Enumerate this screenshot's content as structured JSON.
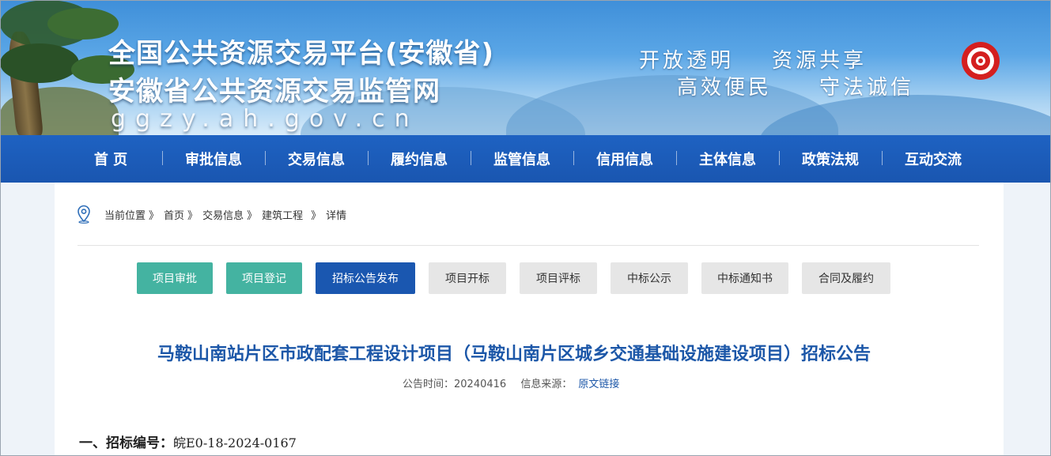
{
  "header": {
    "title_line1": "全国公共资源交易平台(安徽省)",
    "title_line2": "安徽省公共资源交易监管网",
    "domain": "ggzy.ah.gov.cn",
    "slogans": [
      "开放透明",
      "资源共享",
      "高效便民",
      "守法诚信"
    ],
    "logo_color": "#d41f1f"
  },
  "nav": {
    "items": [
      "首 页",
      "审批信息",
      "交易信息",
      "履约信息",
      "监管信息",
      "信用信息",
      "主体信息",
      "政策法规",
      "互动交流"
    ],
    "background": "#1a56b0"
  },
  "breadcrumb": {
    "icon": "location-pin-icon",
    "items": [
      "当前位置",
      "首页",
      "交易信息",
      "建筑工程",
      "详情"
    ],
    "separator": "》"
  },
  "tabs": [
    {
      "label": "项目审批",
      "state": "done"
    },
    {
      "label": "项目登记",
      "state": "done"
    },
    {
      "label": "招标公告发布",
      "state": "active"
    },
    {
      "label": "项目开标",
      "state": "inactive"
    },
    {
      "label": "项目评标",
      "state": "inactive"
    },
    {
      "label": "中标公示",
      "state": "inactive"
    },
    {
      "label": "中标通知书",
      "state": "inactive"
    },
    {
      "label": "合同及履约",
      "state": "inactive"
    }
  ],
  "article": {
    "title": "马鞍山南站片区市政配套工程设计项目（马鞍山南片区城乡交通基础设施建设项目）招标公告",
    "date_label": "公告时间：",
    "date_value": "20240416",
    "source_label": "信息来源：",
    "source_link": "原文链接",
    "section_heading": "一、招标编号：",
    "section_value": "皖E0-18-2024-0167"
  },
  "colors": {
    "accent_blue": "#1a57b0",
    "teal": "#44b3a1",
    "inactive_gray": "#e6e6e6",
    "title_blue": "#1c57a8"
  }
}
